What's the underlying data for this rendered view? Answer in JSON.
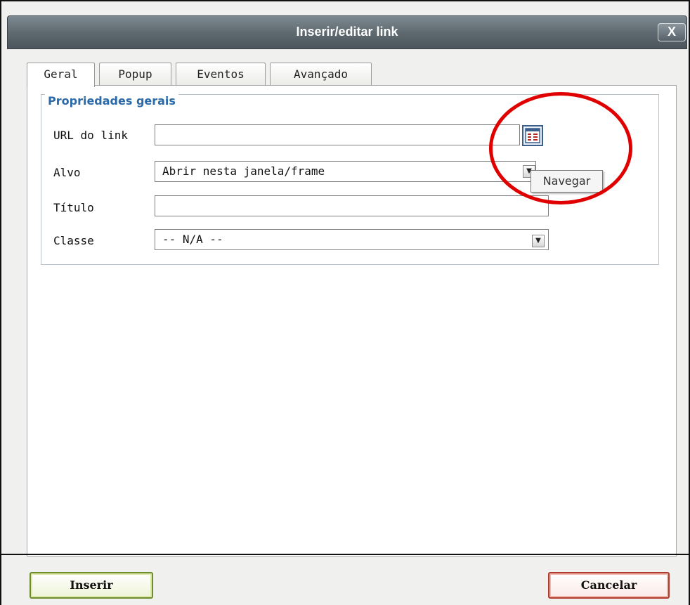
{
  "dialog": {
    "title": "Inserir/editar link",
    "close_label": "X"
  },
  "tabs": [
    {
      "label": "Geral",
      "active": true
    },
    {
      "label": "Popup",
      "active": false
    },
    {
      "label": "Eventos",
      "active": false
    },
    {
      "label": "Avançado",
      "active": false
    }
  ],
  "general": {
    "legend": "Propriedades gerais",
    "url": {
      "label": "URL do link",
      "value": ""
    },
    "target": {
      "label": "Alvo",
      "value": "Abrir nesta janela/frame"
    },
    "title": {
      "label": "Título",
      "value": ""
    },
    "class": {
      "label": "Classe",
      "value": "-- N/A --"
    },
    "browse_tooltip": "Navegar",
    "browse_icon": "browse-icon"
  },
  "buttons": {
    "insert": "Inserir",
    "cancel": "Cancelar"
  },
  "colors": {
    "annotation": "#e00000",
    "legend": "#2a6aa8"
  }
}
